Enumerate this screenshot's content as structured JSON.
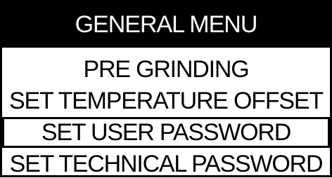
{
  "menu": {
    "title": "GENERAL MENU",
    "items": [
      {
        "label": "PRE GRINDING",
        "selected": false
      },
      {
        "label": "SET TEMPERATURE OFFSET",
        "selected": false
      },
      {
        "label": "SET USER PASSWORD",
        "selected": true
      },
      {
        "label": "SET TECHNICAL PASSWORD",
        "selected": false
      }
    ]
  },
  "colors": {
    "background": "#ffffff",
    "foreground": "#000000",
    "header_background": "#000000",
    "header_text": "#ffffff"
  }
}
